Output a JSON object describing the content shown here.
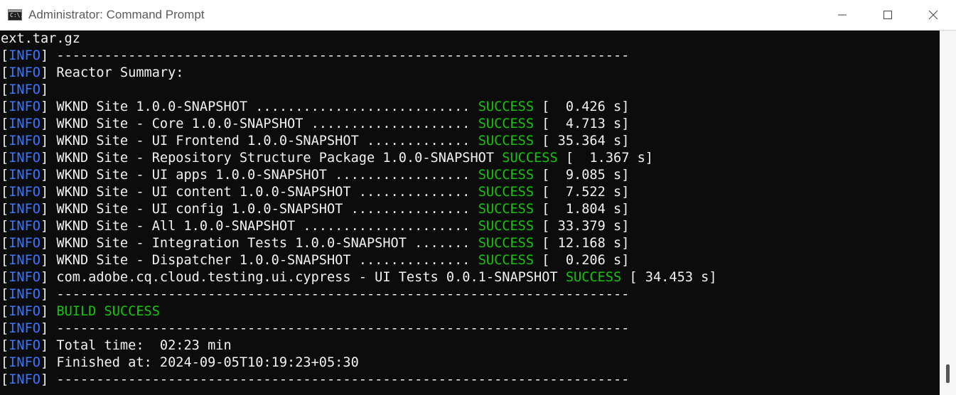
{
  "window": {
    "title": "Administrator: Command Prompt",
    "icon_text": "C:\\.",
    "controls": [
      "minimize-icon",
      "maximize-icon",
      "close-icon"
    ]
  },
  "colors": {
    "info": "#3b78ff",
    "success": "#16c60c",
    "text": "#f2f2f2",
    "background": "#0c0c0c"
  },
  "console": {
    "lines": [
      {
        "text": "ext.tar.gz"
      },
      {
        "tag": "INFO",
        "text": " ------------------------------------------------------------------------"
      },
      {
        "tag": "INFO",
        "text": " Reactor Summary:"
      },
      {
        "tag": "INFO",
        "text": ""
      },
      {
        "tag": "INFO",
        "text": " WKND Site 1.0.0-SNAPSHOT ........................... ",
        "status": "SUCCESS",
        "tail": " [  0.426 s]"
      },
      {
        "tag": "INFO",
        "text": " WKND Site - Core 1.0.0-SNAPSHOT .................... ",
        "status": "SUCCESS",
        "tail": " [  4.713 s]"
      },
      {
        "tag": "INFO",
        "text": " WKND Site - UI Frontend 1.0.0-SNAPSHOT ............. ",
        "status": "SUCCESS",
        "tail": " [ 35.364 s]"
      },
      {
        "tag": "INFO",
        "text": " WKND Site - Repository Structure Package 1.0.0-SNAPSHOT ",
        "status": "SUCCESS",
        "tail": " [  1.367 s]"
      },
      {
        "tag": "INFO",
        "text": " WKND Site - UI apps 1.0.0-SNAPSHOT ................. ",
        "status": "SUCCESS",
        "tail": " [  9.085 s]"
      },
      {
        "tag": "INFO",
        "text": " WKND Site - UI content 1.0.0-SNAPSHOT .............. ",
        "status": "SUCCESS",
        "tail": " [  7.522 s]"
      },
      {
        "tag": "INFO",
        "text": " WKND Site - UI config 1.0.0-SNAPSHOT ............... ",
        "status": "SUCCESS",
        "tail": " [  1.804 s]"
      },
      {
        "tag": "INFO",
        "text": " WKND Site - All 1.0.0-SNAPSHOT ..................... ",
        "status": "SUCCESS",
        "tail": " [ 33.379 s]"
      },
      {
        "tag": "INFO",
        "text": " WKND Site - Integration Tests 1.0.0-SNAPSHOT ....... ",
        "status": "SUCCESS",
        "tail": " [ 12.168 s]"
      },
      {
        "tag": "INFO",
        "text": " WKND Site - Dispatcher 1.0.0-SNAPSHOT .............. ",
        "status": "SUCCESS",
        "tail": " [  0.206 s]"
      },
      {
        "tag": "INFO",
        "text": " com.adobe.cq.cloud.testing.ui.cypress - UI Tests 0.0.1-SNAPSHOT ",
        "status": "SUCCESS",
        "tail": " [ 34.453 s]"
      },
      {
        "tag": "INFO",
        "text": " ------------------------------------------------------------------------"
      },
      {
        "tag": "INFO",
        "text": " ",
        "status": "BUILD SUCCESS"
      },
      {
        "tag": "INFO",
        "text": " ------------------------------------------------------------------------"
      },
      {
        "tag": "INFO",
        "text": " Total time:  02:23 min"
      },
      {
        "tag": "INFO",
        "text": " Finished at: 2024-09-05T10:19:23+05:30"
      },
      {
        "tag": "INFO",
        "text": " ------------------------------------------------------------------------"
      }
    ]
  }
}
